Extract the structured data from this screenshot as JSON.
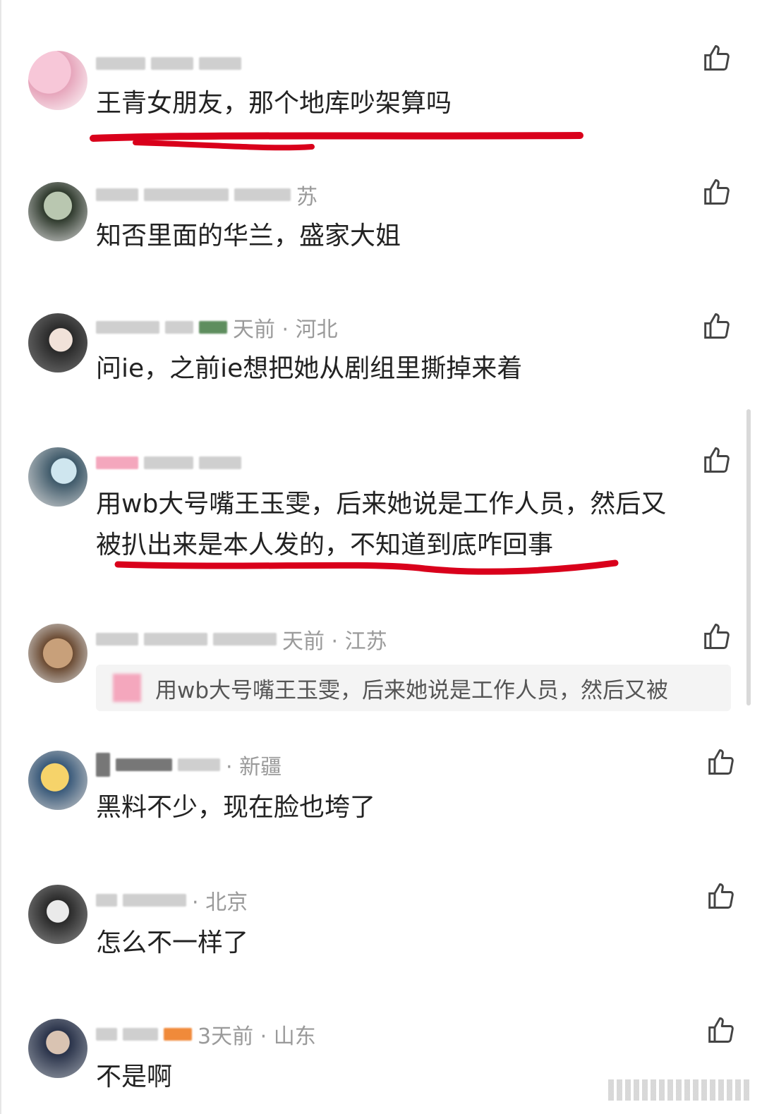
{
  "comments": [
    {
      "meta": "",
      "text": "王青女朋友，那个地库吵架算吗"
    },
    {
      "meta": "苏",
      "text": "知否里面的华兰，盛家大姐"
    },
    {
      "meta": "天前 · 河北",
      "text": "问ie，之前ie想把她从剧组里撕掉来着"
    },
    {
      "meta": "",
      "text_line1": "用wb大号嘴王玉雯，后来她说是工作人员，然后又",
      "text_line2": "被扒出来是本人发的，不知道到底咋回事"
    },
    {
      "meta": "天前 · 江苏",
      "quote": "用wb大号嘴王玉雯，后来她说是工作人员，然后又被"
    },
    {
      "meta": "· 新疆",
      "text": "黑料不少，现在脸也垮了"
    },
    {
      "meta": "· 北京",
      "text": "怎么不一样了"
    },
    {
      "meta": "3天前 · 山东",
      "text": "不是啊"
    }
  ],
  "icons": {
    "like": "thumbs-up-icon",
    "avatar": "user-avatar"
  },
  "colors": {
    "underline": "#d9001b",
    "meta": "#9a9a9a"
  }
}
